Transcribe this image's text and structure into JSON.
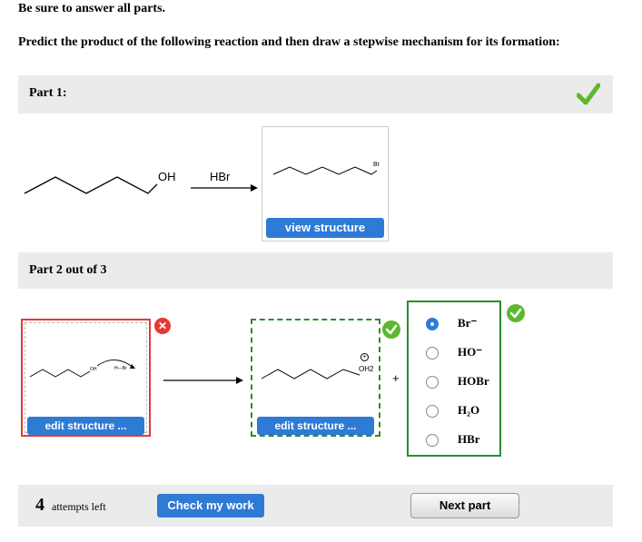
{
  "header": {
    "instruction": "Be sure to answer all parts.",
    "question": "Predict the product of the following reaction and then draw a stepwise mechanism for its formation:"
  },
  "part1": {
    "label": "Part 1:",
    "reactant_oh": "OH",
    "reagent": "HBr",
    "product_br": "Br",
    "view_button": "view structure"
  },
  "part2": {
    "label": "Part 2 out of 3",
    "left_edit_button": "edit structure ...",
    "right_edit_button": "edit structure ...",
    "mech_oh": "OH",
    "mech_hbr": "H—Br",
    "mech_oh2": "OH2",
    "mech_plus_charge": "+",
    "plus_sign": "+",
    "options": [
      {
        "label": "Br⁻",
        "selected": true
      },
      {
        "label": "HO⁻",
        "selected": false
      },
      {
        "label": "HOBr",
        "selected": false
      },
      {
        "label": "H₂O",
        "selected": false
      },
      {
        "label": "HBr",
        "selected": false
      }
    ]
  },
  "footer": {
    "attempts_number": "4",
    "attempts_text": "attempts left",
    "check_button": "Check my work",
    "next_button": "Next part"
  },
  "colors": {
    "correct_green": "#5cb82e",
    "wrong_red": "#e53935",
    "accent_blue": "#2e7bd6"
  }
}
